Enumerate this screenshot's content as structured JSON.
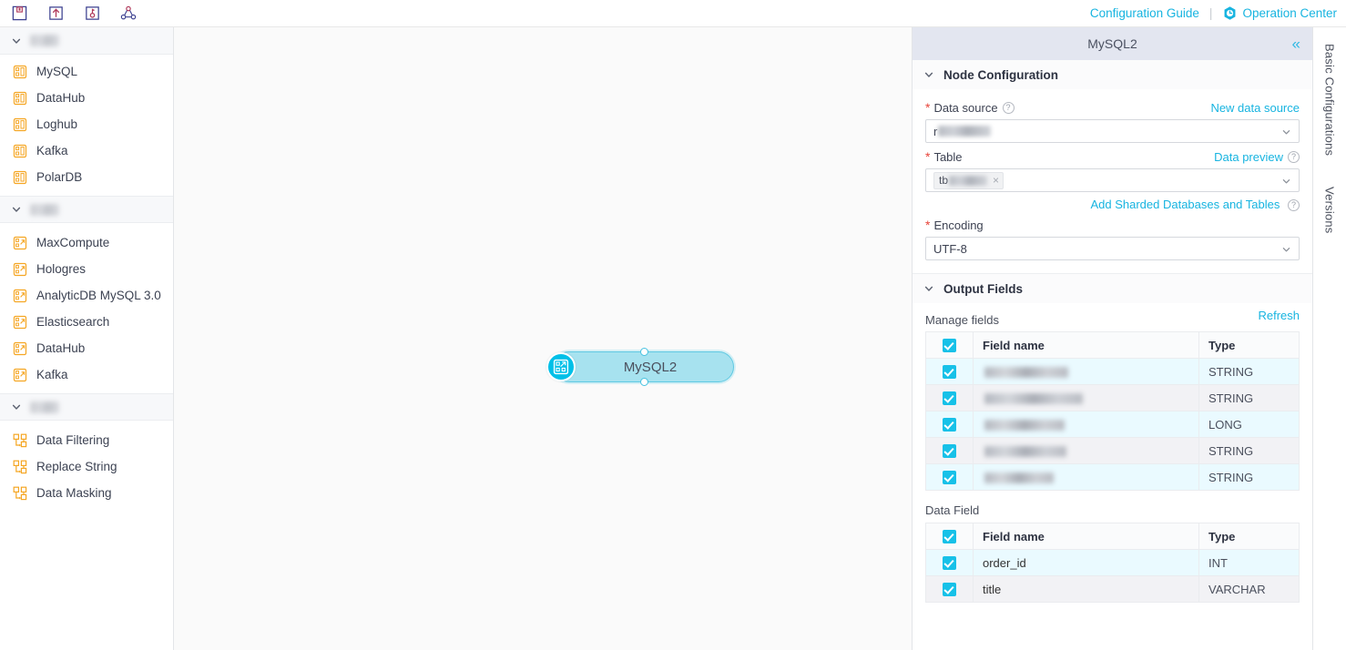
{
  "toolbar": {
    "buttons": [
      {
        "name": "save-icon",
        "title": "Save"
      },
      {
        "name": "submit-upload-icon",
        "title": "Submit"
      },
      {
        "name": "publish-icon",
        "title": "Publish"
      },
      {
        "name": "topology-icon",
        "title": "Topology"
      }
    ],
    "configuration_guide": "Configuration Guide",
    "separator": "|",
    "operation_center": "Operation Center",
    "operation_center_icon": "operation-center-badge-icon"
  },
  "sidebar": {
    "groups": [
      {
        "label_redacted": true,
        "icon_kind": "source",
        "items": [
          {
            "label": "MySQL"
          },
          {
            "label": "DataHub"
          },
          {
            "label": "Loghub"
          },
          {
            "label": "Kafka"
          },
          {
            "label": "PolarDB"
          }
        ]
      },
      {
        "label_redacted": true,
        "icon_kind": "sink",
        "items": [
          {
            "label": "MaxCompute"
          },
          {
            "label": "Hologres"
          },
          {
            "label": "AnalyticDB MySQL 3.0"
          },
          {
            "label": "Elasticsearch"
          },
          {
            "label": "DataHub"
          },
          {
            "label": "Kafka"
          }
        ]
      },
      {
        "label_redacted": true,
        "icon_kind": "transform",
        "items": [
          {
            "label": "Data Filtering"
          },
          {
            "label": "Replace String"
          },
          {
            "label": "Data Masking"
          }
        ]
      }
    ]
  },
  "canvas": {
    "node": {
      "label": "MySQL2",
      "icon": "mysql-source-node-icon",
      "selected": true,
      "ports": [
        "top",
        "bottom"
      ]
    }
  },
  "panel": {
    "title": "MySQL2",
    "collapse_icon": "«",
    "node_configuration": {
      "section_title": "Node Configuration",
      "data_source": {
        "label": "Data source",
        "required": true,
        "help_icon": "question-mark-icon",
        "action_label": "New data source",
        "value_redacted_prefix": "r",
        "value_redacted": true
      },
      "table": {
        "label": "Table",
        "required": true,
        "action_label": "Data preview",
        "help_icon": "question-mark-icon",
        "tag_prefix": "tb",
        "tag_redacted": true,
        "tag_close_icon": "×"
      },
      "sharded_link": "Add Sharded Databases and Tables",
      "encoding": {
        "label": "Encoding",
        "required": true,
        "value": "UTF-8"
      }
    },
    "output_fields": {
      "section_title": "Output Fields",
      "refresh_label": "Refresh",
      "manage_fields_label": "Manage fields",
      "columns": [
        "Field name",
        "Type"
      ],
      "rows": [
        {
          "checked": true,
          "name_redacted": true,
          "type": "STRING"
        },
        {
          "checked": true,
          "name_redacted": true,
          "type": "STRING"
        },
        {
          "checked": true,
          "name_redacted": true,
          "type": "LONG"
        },
        {
          "checked": true,
          "name_redacted": true,
          "type": "STRING"
        },
        {
          "checked": true,
          "name_redacted": true,
          "type": "STRING"
        }
      ],
      "data_field_label": "Data Field",
      "data_field_columns": [
        "Field name",
        "Type"
      ],
      "data_field_rows": [
        {
          "checked": true,
          "name": "order_id",
          "type": "INT"
        },
        {
          "checked": true,
          "name": "title",
          "type": "VARCHAR"
        }
      ]
    }
  },
  "vertical_tabs": [
    {
      "label": "Basic Configurations"
    },
    {
      "label": "Versions"
    }
  ],
  "colors": {
    "accent": "#17b4e0",
    "node_fill": "#a7e2ef",
    "node_icon": "#00c0e8",
    "checkbox": "#17c1e8",
    "required": "#e8443a",
    "panel_header": "#e3e6f0",
    "sidebar_icon": "#f5a623"
  }
}
